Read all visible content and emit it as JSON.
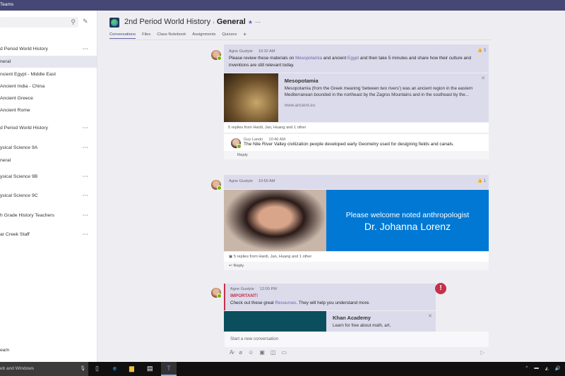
{
  "window": {
    "title": "Teams"
  },
  "sidebar": {
    "search_placeholder": "",
    "items": [
      {
        "label": "d Period World History",
        "type": "team"
      },
      {
        "label": "neral",
        "type": "channel",
        "selected": true
      },
      {
        "label": "ncient Egypt - Middle East",
        "type": "channel"
      },
      {
        "label": "Ancient India - China",
        "type": "channel"
      },
      {
        "label": "Ancient Greece",
        "type": "channel"
      },
      {
        "label": "Ancient Rome",
        "type": "channel"
      },
      {
        "label": "d Period World History",
        "type": "team"
      },
      {
        "label": "ysical Science 9A",
        "type": "team"
      },
      {
        "label": "neral",
        "type": "channel"
      },
      {
        "label": "ysical Science 9B",
        "type": "team"
      },
      {
        "label": "ysical Science 9C",
        "type": "team"
      },
      {
        "label": "h Grade History Teachers",
        "type": "team"
      },
      {
        "label": "ar Creek Staff",
        "type": "team"
      }
    ],
    "more_label": "···",
    "join_label": "eam"
  },
  "header": {
    "team": "2nd Period World History",
    "separator": "›",
    "channel": "General",
    "more": "···",
    "tabs": [
      "Conversations",
      "Files",
      "Class Notebook",
      "Assignments",
      "Quizzes"
    ],
    "add_tab": "+"
  },
  "messages": [
    {
      "author": "Agne Gustyte",
      "time": "10:32 AM",
      "likes": "3",
      "text_parts": [
        "Please review these materials on ",
        "Mesopotamia",
        " and ancient ",
        "Egypt",
        " and then take 5 minutes and share how their culture and inventions are still relevant today."
      ],
      "preview": {
        "title": "Mesopotamia",
        "desc": "Mesopotamia (from the Greek meaning 'between two rivers') was an ancient region in the eastern Mediterranean bounded in the northeast by the Zagros Mountains and in the southeast by the...",
        "url": "www.ancient.eu"
      },
      "replies_summary": "5 replies from Hardi, Jan, Huang and 1 other",
      "reply": {
        "author": "Guy Lando",
        "time": "10:46 AM",
        "text": "The Nile River Valley civilization people developed early Geometry used for designing fields and canals."
      },
      "reply_label": "Reply"
    },
    {
      "author": "Agne Gustyte",
      "time": "10:50 AM",
      "likes": "1",
      "announcement": {
        "line1": "Please welcome noted anthropologist",
        "line2": "Dr. Johanna Lorenz"
      },
      "replies_summary": "5 replies from Hardi, Jan, Huang and 1 other",
      "reply_label": "Reply"
    },
    {
      "author": "Agne Gustyte",
      "time": "12:00 PM",
      "important": "IMPORTANT!",
      "text_parts": [
        "Check out these great ",
        "Resources",
        ". They will help you understand more."
      ],
      "preview": {
        "title": "Khan Academy",
        "desc": "Learn for free about math, art,"
      }
    }
  ],
  "compose": {
    "placeholder": "Start a new conversation"
  },
  "taskbar": {
    "search_text": "eb and Windows"
  },
  "colors": {
    "accent": "#6264a7",
    "titlebar": "#464775",
    "important": "#c4314b",
    "announcement": "#0078d4"
  }
}
